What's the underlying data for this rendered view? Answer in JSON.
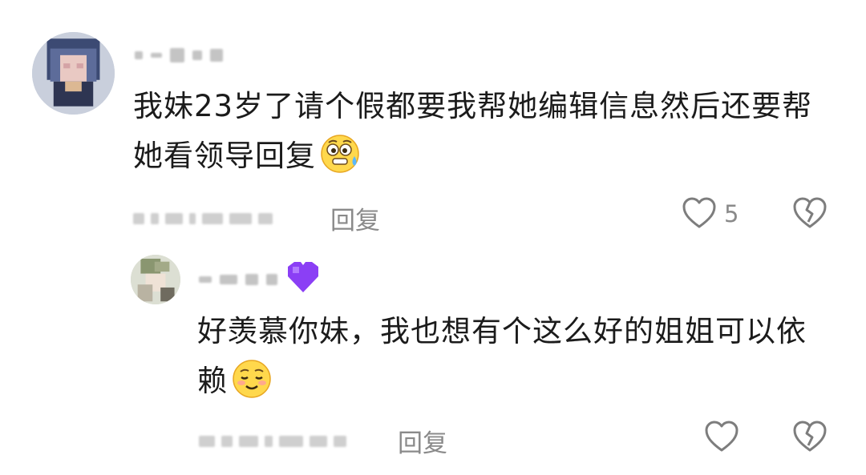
{
  "comments": [
    {
      "text": "我妹23岁了请个假都要我帮她编辑信息然后还要帮她看领导回复",
      "emoji": "anxious-sweat-emoji",
      "reply_label": "回复",
      "like_count": "5"
    },
    {
      "text": "好羡慕你妹，我也想有个这么好的姐姐可以依赖",
      "emoji": "smiling-blush-emoji",
      "reply_label": "回复",
      "like_count": ""
    }
  ],
  "icons": {
    "like": "heart-outline-icon",
    "dislike": "broken-heart-icon",
    "badge": "purple-heart-icon"
  },
  "colors": {
    "text": "#1b1b1b",
    "meta": "#8a8a8a",
    "badge": "#8b3ff5"
  }
}
